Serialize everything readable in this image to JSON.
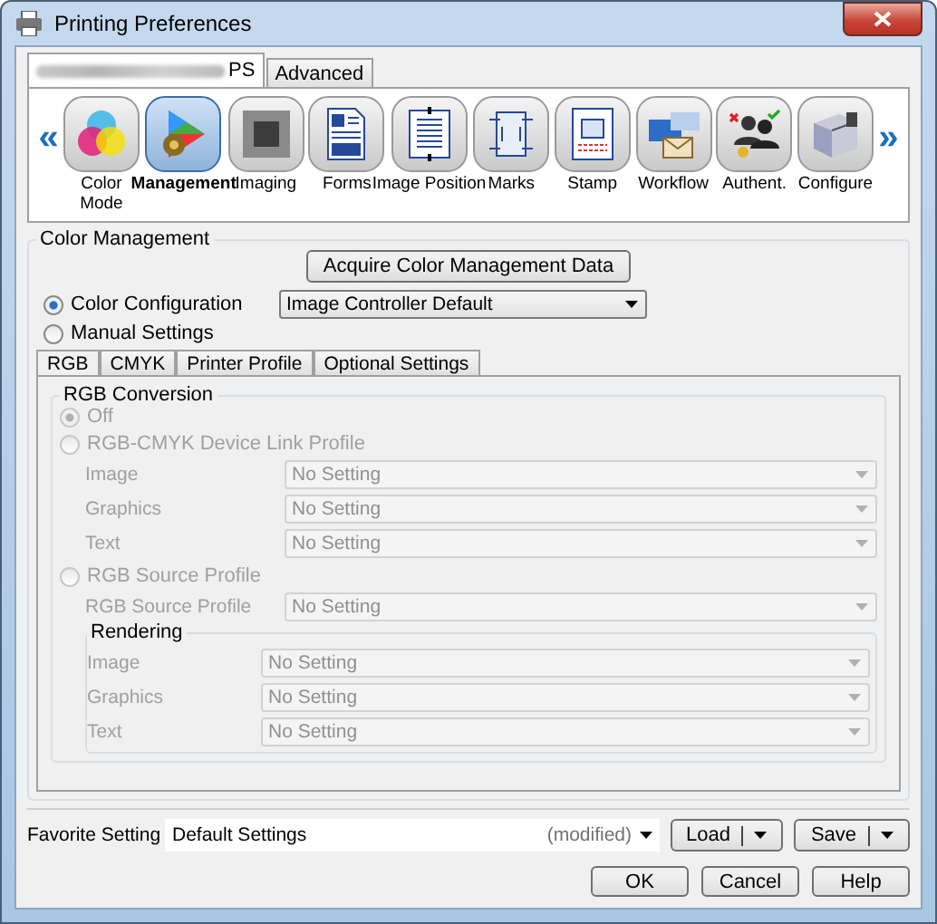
{
  "window": {
    "title": "Printing Preferences"
  },
  "tabs": [
    {
      "label": "PS",
      "selected": true
    },
    {
      "label": "Advanced",
      "selected": false
    }
  ],
  "nav": {
    "prev": "«",
    "next": "»"
  },
  "categories": [
    {
      "label": "Color Mode",
      "kind": "color-mode",
      "selected": false
    },
    {
      "label": "Management",
      "kind": "management",
      "selected": true
    },
    {
      "label": "Imaging",
      "kind": "imaging",
      "selected": false
    },
    {
      "label": "Forms",
      "kind": "forms",
      "selected": false
    },
    {
      "label": "Image Position",
      "kind": "position",
      "selected": false
    },
    {
      "label": "Marks",
      "kind": "marks",
      "selected": false
    },
    {
      "label": "Stamp",
      "kind": "stamp",
      "selected": false
    },
    {
      "label": "Workflow",
      "kind": "workflow",
      "selected": false
    },
    {
      "label": "Authent.",
      "kind": "authent",
      "selected": false
    },
    {
      "label": "Configure",
      "kind": "configure",
      "selected": false
    }
  ],
  "color_management": {
    "title": "Color Management",
    "acquire_button": "Acquire Color Management Data",
    "modes": [
      {
        "label": "Color Configuration",
        "selected": true
      },
      {
        "label": "Manual Settings",
        "selected": false
      }
    ],
    "configuration_value": "Image Controller Default",
    "subtabs": [
      {
        "label": "RGB",
        "selected": true
      },
      {
        "label": "CMYK",
        "selected": false
      },
      {
        "label": "Printer Profile",
        "selected": false
      },
      {
        "label": "Optional Settings",
        "selected": false
      }
    ],
    "rgb_conversion": {
      "title": "RGB Conversion",
      "disabled": true,
      "off": {
        "label": "Off",
        "selected": true
      },
      "device_link": {
        "label": "RGB-CMYK Device Link Profile",
        "selected": false,
        "fields": [
          {
            "label": "Image",
            "value": "No Setting"
          },
          {
            "label": "Graphics",
            "value": "No Setting"
          },
          {
            "label": "Text",
            "value": "No Setting"
          }
        ]
      },
      "source_profile": {
        "label": "RGB Source Profile",
        "selected": false,
        "fields": [
          {
            "label": "RGB Source Profile",
            "value": "No Setting"
          }
        ],
        "rendering": {
          "title": "Rendering",
          "fields": [
            {
              "label": "Image",
              "value": "No Setting"
            },
            {
              "label": "Graphics",
              "value": "No Setting"
            },
            {
              "label": "Text",
              "value": "No Setting"
            }
          ]
        }
      }
    }
  },
  "favorite": {
    "label": "Favorite Setting",
    "value": "Default Settings",
    "note": "(modified)",
    "load": "Load",
    "save": "Save"
  },
  "buttons": [
    "OK",
    "Cancel",
    "Help"
  ]
}
